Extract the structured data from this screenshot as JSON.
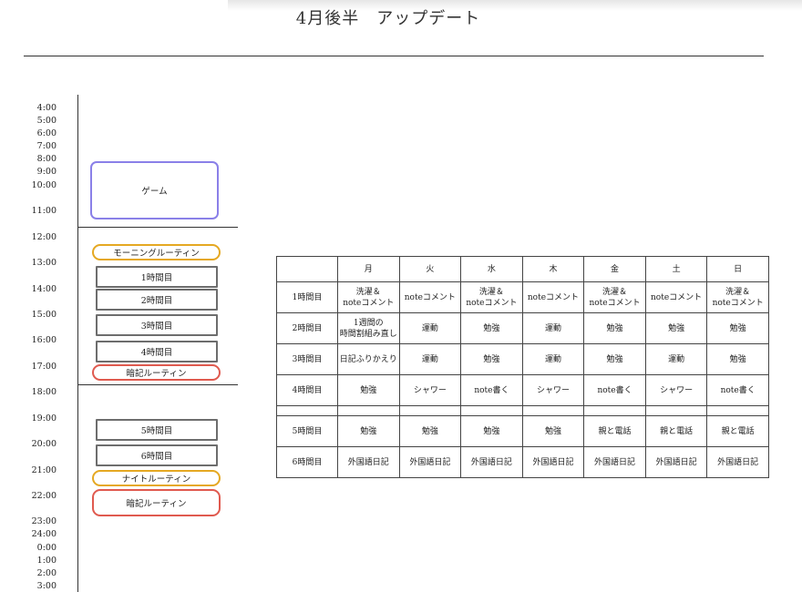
{
  "header": {
    "title": "4月後半　アップデート"
  },
  "timeline": {
    "times": [
      "4:00",
      "5:00",
      "6:00",
      "7:00",
      "8:00",
      "9:00",
      "10:00",
      "11:00",
      "12:00",
      "13:00",
      "14:00",
      "15:00",
      "16:00",
      "17:00",
      "18:00",
      "19:00",
      "20:00",
      "21:00",
      "22:00",
      "23:00",
      "24:00",
      "0:00",
      "1:00",
      "2:00",
      "3:00"
    ],
    "blocks": {
      "game": "ゲーム",
      "morning_routine": "モーニングルーティン",
      "period_1": "1時間目",
      "period_2": "2時間目",
      "period_3": "3時間目",
      "period_4": "4時間目",
      "memorize_routine_1": "暗記ルーティン",
      "period_5": "5時間目",
      "period_6": "6時間目",
      "night_routine": "ナイトルーティン",
      "memorize_routine_2": "暗記ルーティン"
    },
    "colors": {
      "game": "#8a80e8",
      "routine": "#e5a822",
      "memorize": "#e05a4f",
      "period": "#6d6d6d"
    }
  },
  "schedule": {
    "days": [
      "月",
      "火",
      "水",
      "木",
      "金",
      "土",
      "日"
    ],
    "rows": [
      {
        "label": "1時間目",
        "cells": [
          "洗濯＆\nnoteコメント",
          "noteコメント",
          "洗濯＆\nnoteコメント",
          "noteコメント",
          "洗濯＆\nnoteコメント",
          "noteコメント",
          "洗濯＆\nnoteコメント"
        ]
      },
      {
        "label": "2時間目",
        "cells": [
          "1週間の\n時間割組み直し",
          "運動",
          "勉強",
          "運動",
          "勉強",
          "勉強",
          "勉強"
        ]
      },
      {
        "label": "3時間目",
        "cells": [
          "日記ふりかえり",
          "運動",
          "勉強",
          "運動",
          "勉強",
          "運動",
          "勉強"
        ]
      },
      {
        "label": "4時間目",
        "cells": [
          "勉強",
          "シャワー",
          "note書く",
          "シャワー",
          "note書く",
          "シャワー",
          "note書く"
        ]
      },
      {
        "label": "5時間目",
        "cells": [
          "勉強",
          "勉強",
          "勉強",
          "勉強",
          "親と電話",
          "親と電話",
          "親と電話"
        ]
      },
      {
        "label": "6時間目",
        "cells": [
          "外国語日記",
          "外国語日記",
          "外国語日記",
          "外国語日記",
          "外国語日記",
          "外国語日記",
          "外国語日記"
        ]
      }
    ]
  }
}
